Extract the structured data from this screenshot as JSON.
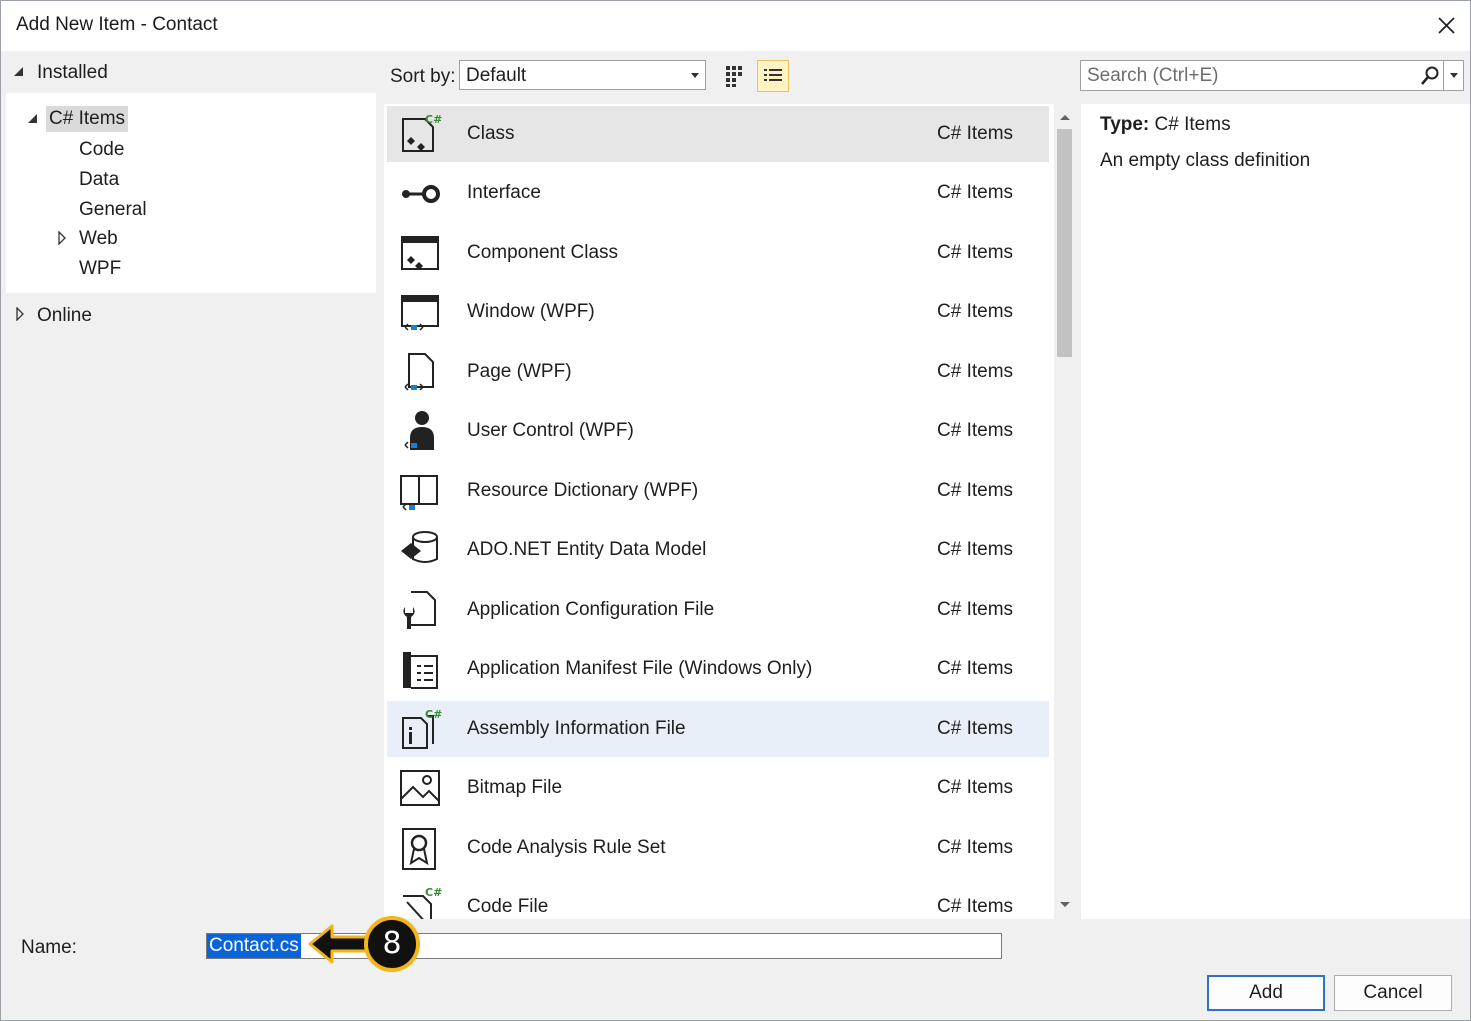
{
  "window": {
    "title": "Add New Item - Contact"
  },
  "tree": {
    "installed": "Installed",
    "csharp_items": "C# Items",
    "children": [
      "Code",
      "Data",
      "General",
      "Web",
      "WPF"
    ],
    "online": "Online"
  },
  "toolbar": {
    "sort_label": "Sort by:",
    "sort_value": "Default",
    "search_placeholder": "Search (Ctrl+E)"
  },
  "items": [
    {
      "name": "Class",
      "category": "C# Items",
      "icon": "class-icon"
    },
    {
      "name": "Interface",
      "category": "C# Items",
      "icon": "interface-icon"
    },
    {
      "name": "Component Class",
      "category": "C# Items",
      "icon": "component-class-icon"
    },
    {
      "name": "Window (WPF)",
      "category": "C# Items",
      "icon": "window-icon"
    },
    {
      "name": "Page (WPF)",
      "category": "C# Items",
      "icon": "page-icon"
    },
    {
      "name": "User Control (WPF)",
      "category": "C# Items",
      "icon": "user-control-icon"
    },
    {
      "name": "Resource Dictionary (WPF)",
      "category": "C# Items",
      "icon": "resource-dictionary-icon"
    },
    {
      "name": "ADO.NET Entity Data Model",
      "category": "C# Items",
      "icon": "entity-model-icon"
    },
    {
      "name": "Application Configuration File",
      "category": "C# Items",
      "icon": "config-file-icon"
    },
    {
      "name": "Application Manifest File (Windows Only)",
      "category": "C# Items",
      "icon": "manifest-file-icon"
    },
    {
      "name": "Assembly Information File",
      "category": "C# Items",
      "icon": "assembly-info-icon"
    },
    {
      "name": "Bitmap File",
      "category": "C# Items",
      "icon": "bitmap-icon"
    },
    {
      "name": "Code Analysis Rule Set",
      "category": "C# Items",
      "icon": "rule-set-icon"
    },
    {
      "name": "Code File",
      "category": "C# Items",
      "icon": "code-file-icon"
    }
  ],
  "details": {
    "type_label": "Type:",
    "type_value": "C# Items",
    "description": "An empty class definition"
  },
  "form": {
    "name_label": "Name:",
    "name_value": "Contact.cs"
  },
  "buttons": {
    "add": "Add",
    "cancel": "Cancel"
  },
  "callout": {
    "number": "8"
  }
}
